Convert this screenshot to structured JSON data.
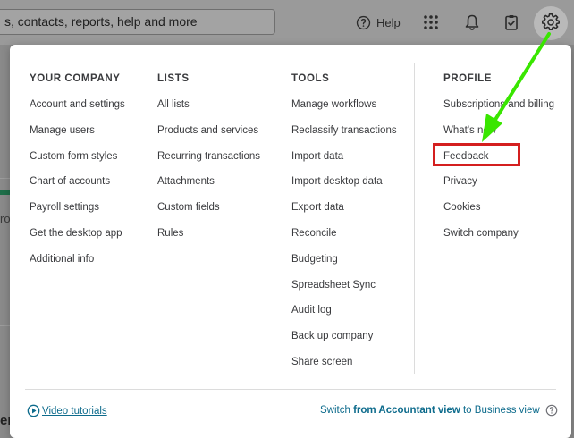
{
  "topbar": {
    "search_text": "s, contacts, reports, help and more",
    "help_label": "Help",
    "icons": [
      "help-circle-icon",
      "apps-grid-icon",
      "bell-icon",
      "clipboard-icon",
      "gear-icon"
    ]
  },
  "background": {
    "fragment_r": "ro",
    "fragment_er": "er"
  },
  "menu": {
    "company": {
      "heading": "YOUR COMPANY",
      "items": [
        "Account and settings",
        "Manage users",
        "Custom form styles",
        "Chart of accounts",
        "Payroll settings",
        "Get the desktop app",
        "Additional info"
      ]
    },
    "lists": {
      "heading": "LISTS",
      "items": [
        "All lists",
        "Products and services",
        "Recurring transactions",
        "Attachments",
        "Custom fields",
        "Rules"
      ]
    },
    "tools": {
      "heading": "TOOLS",
      "items": [
        "Manage workflows",
        "Reclassify transactions",
        "Import data",
        "Import desktop data",
        "Export data",
        "Reconcile",
        "Budgeting",
        "Spreadsheet Sync",
        "Audit log",
        "Back up company",
        "Share screen"
      ]
    },
    "profile": {
      "heading": "PROFILE",
      "items": [
        "Subscriptions and billing",
        "What's new",
        "Feedback",
        "Privacy",
        "Cookies",
        "Switch company"
      ]
    }
  },
  "footer": {
    "video_label": "Video tutorials",
    "switch_prefix": "Switch",
    "switch_bold1": "from Accountant view",
    "switch_mid": "to",
    "switch_bold2": "Business view"
  },
  "colors": {
    "link": "#0d6b8c",
    "highlight": "#d41f1f",
    "arrow": "#39e600",
    "text": "#393a3d"
  }
}
